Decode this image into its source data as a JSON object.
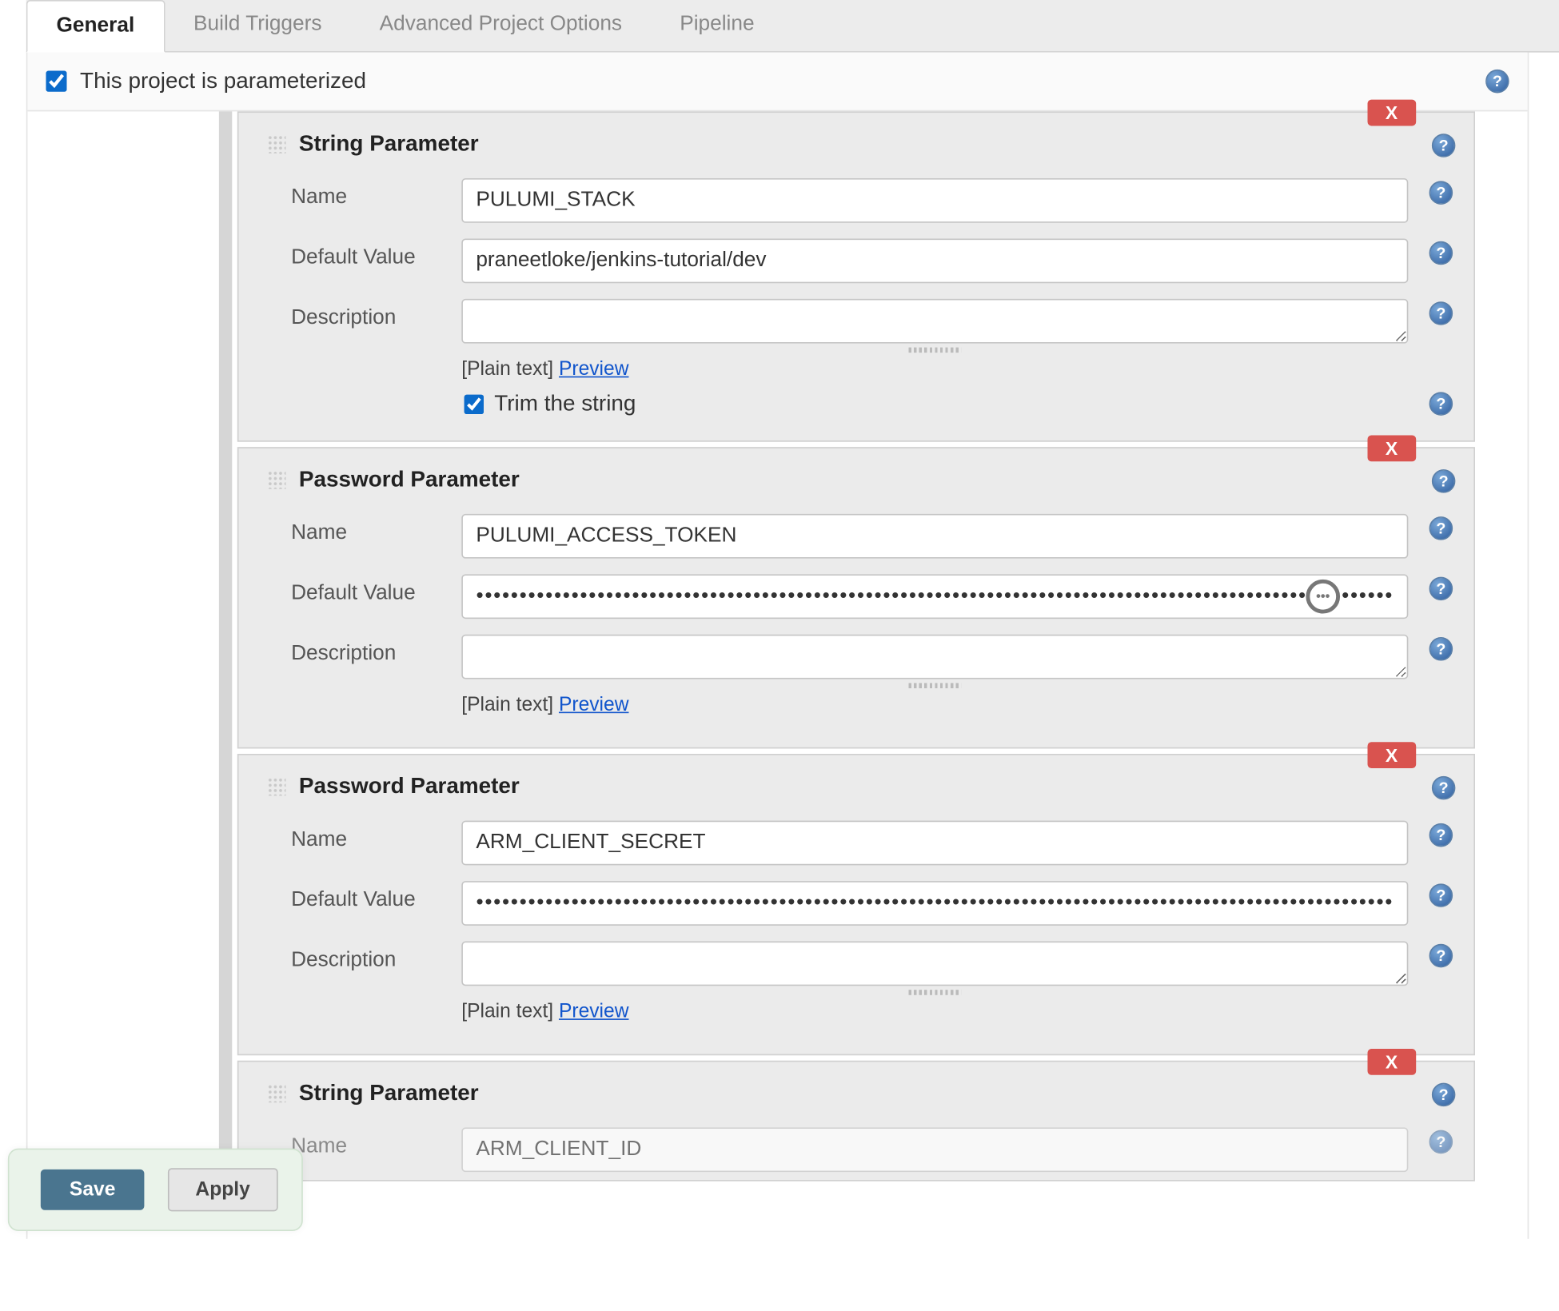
{
  "tabs": {
    "general": "General",
    "build_triggers": "Build Triggers",
    "advanced": "Advanced Project Options",
    "pipeline": "Pipeline"
  },
  "parameterized_label": "This project is parameterized",
  "parameterized_checked": true,
  "labels": {
    "name": "Name",
    "default_value": "Default Value",
    "description": "Description",
    "plain_text_prefix": "[Plain text] ",
    "preview": "Preview",
    "trim": "Trim the string",
    "delete": "X"
  },
  "param_types": {
    "string": "String Parameter",
    "password": "Password Parameter"
  },
  "parameters": [
    {
      "type": "string",
      "name": "PULUMI_STACK",
      "default_value": "praneetloke/jenkins-tutorial/dev",
      "description": "",
      "trim": true
    },
    {
      "type": "password",
      "name": "PULUMI_ACCESS_TOKEN",
      "default_value": "••••••••••••••••••••••••••••••••••••••••••••••••••••••••••••••••••••••••••••••••••••••••••••••••••••••••••••••••••••••••••••••••",
      "description": "",
      "show_eye": true
    },
    {
      "type": "password",
      "name": "ARM_CLIENT_SECRET",
      "default_value": "••••••••••••••••••••••••••••••••••••••••••••••••••••••••••••••••••••••••••••••••••••••••••••••••••••••••••••••••••••••••••••••••",
      "description": ""
    },
    {
      "type": "string",
      "name": "ARM_CLIENT_ID",
      "default_value": "",
      "description": ""
    }
  ],
  "buttons": {
    "save": "Save",
    "apply": "Apply"
  }
}
